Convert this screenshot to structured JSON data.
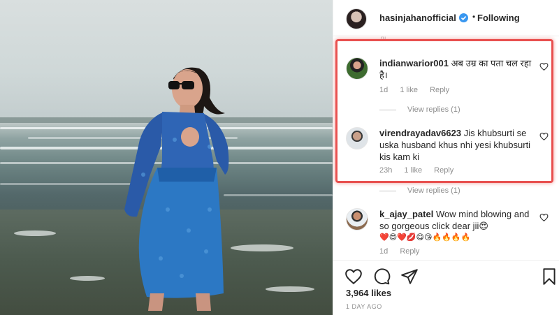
{
  "post": {
    "username": "hasinjahanofficial",
    "separator": "•",
    "follow_label": "Following",
    "truncated_above": "ru",
    "likes": "3,964 likes",
    "date": "1 DAY AGO"
  },
  "comments": [
    {
      "username": "indianwarior001",
      "text": "अब उम्र का पता चल रहा है।",
      "time": "1d",
      "likes": "1 like",
      "reply_label": "Reply",
      "view_replies": "View replies (1)"
    },
    {
      "username": "virendrayadav6623",
      "text": "Jis khubsurti se uska husband khus nhi yesi khubsurti kis kam ki",
      "time": "23h",
      "likes": "1 like",
      "reply_label": "Reply",
      "view_replies": "View replies (1)"
    },
    {
      "username": "k_ajay_patel",
      "text": "Wow mind blowing and so gorgeous click dear jii😍",
      "emoji_line": "❤️😍❤️💋😋😘🔥🔥🔥🔥",
      "time": "1d",
      "reply_label": "Reply"
    }
  ],
  "icons": {
    "verified": "verified-badge-icon",
    "like": "heart-icon",
    "comment": "comment-icon",
    "share": "share-icon",
    "save": "bookmark-icon"
  },
  "colors": {
    "highlight": "#e8504f",
    "verified": "#3897f0",
    "text": "#262626",
    "meta": "#8e8e8e"
  }
}
